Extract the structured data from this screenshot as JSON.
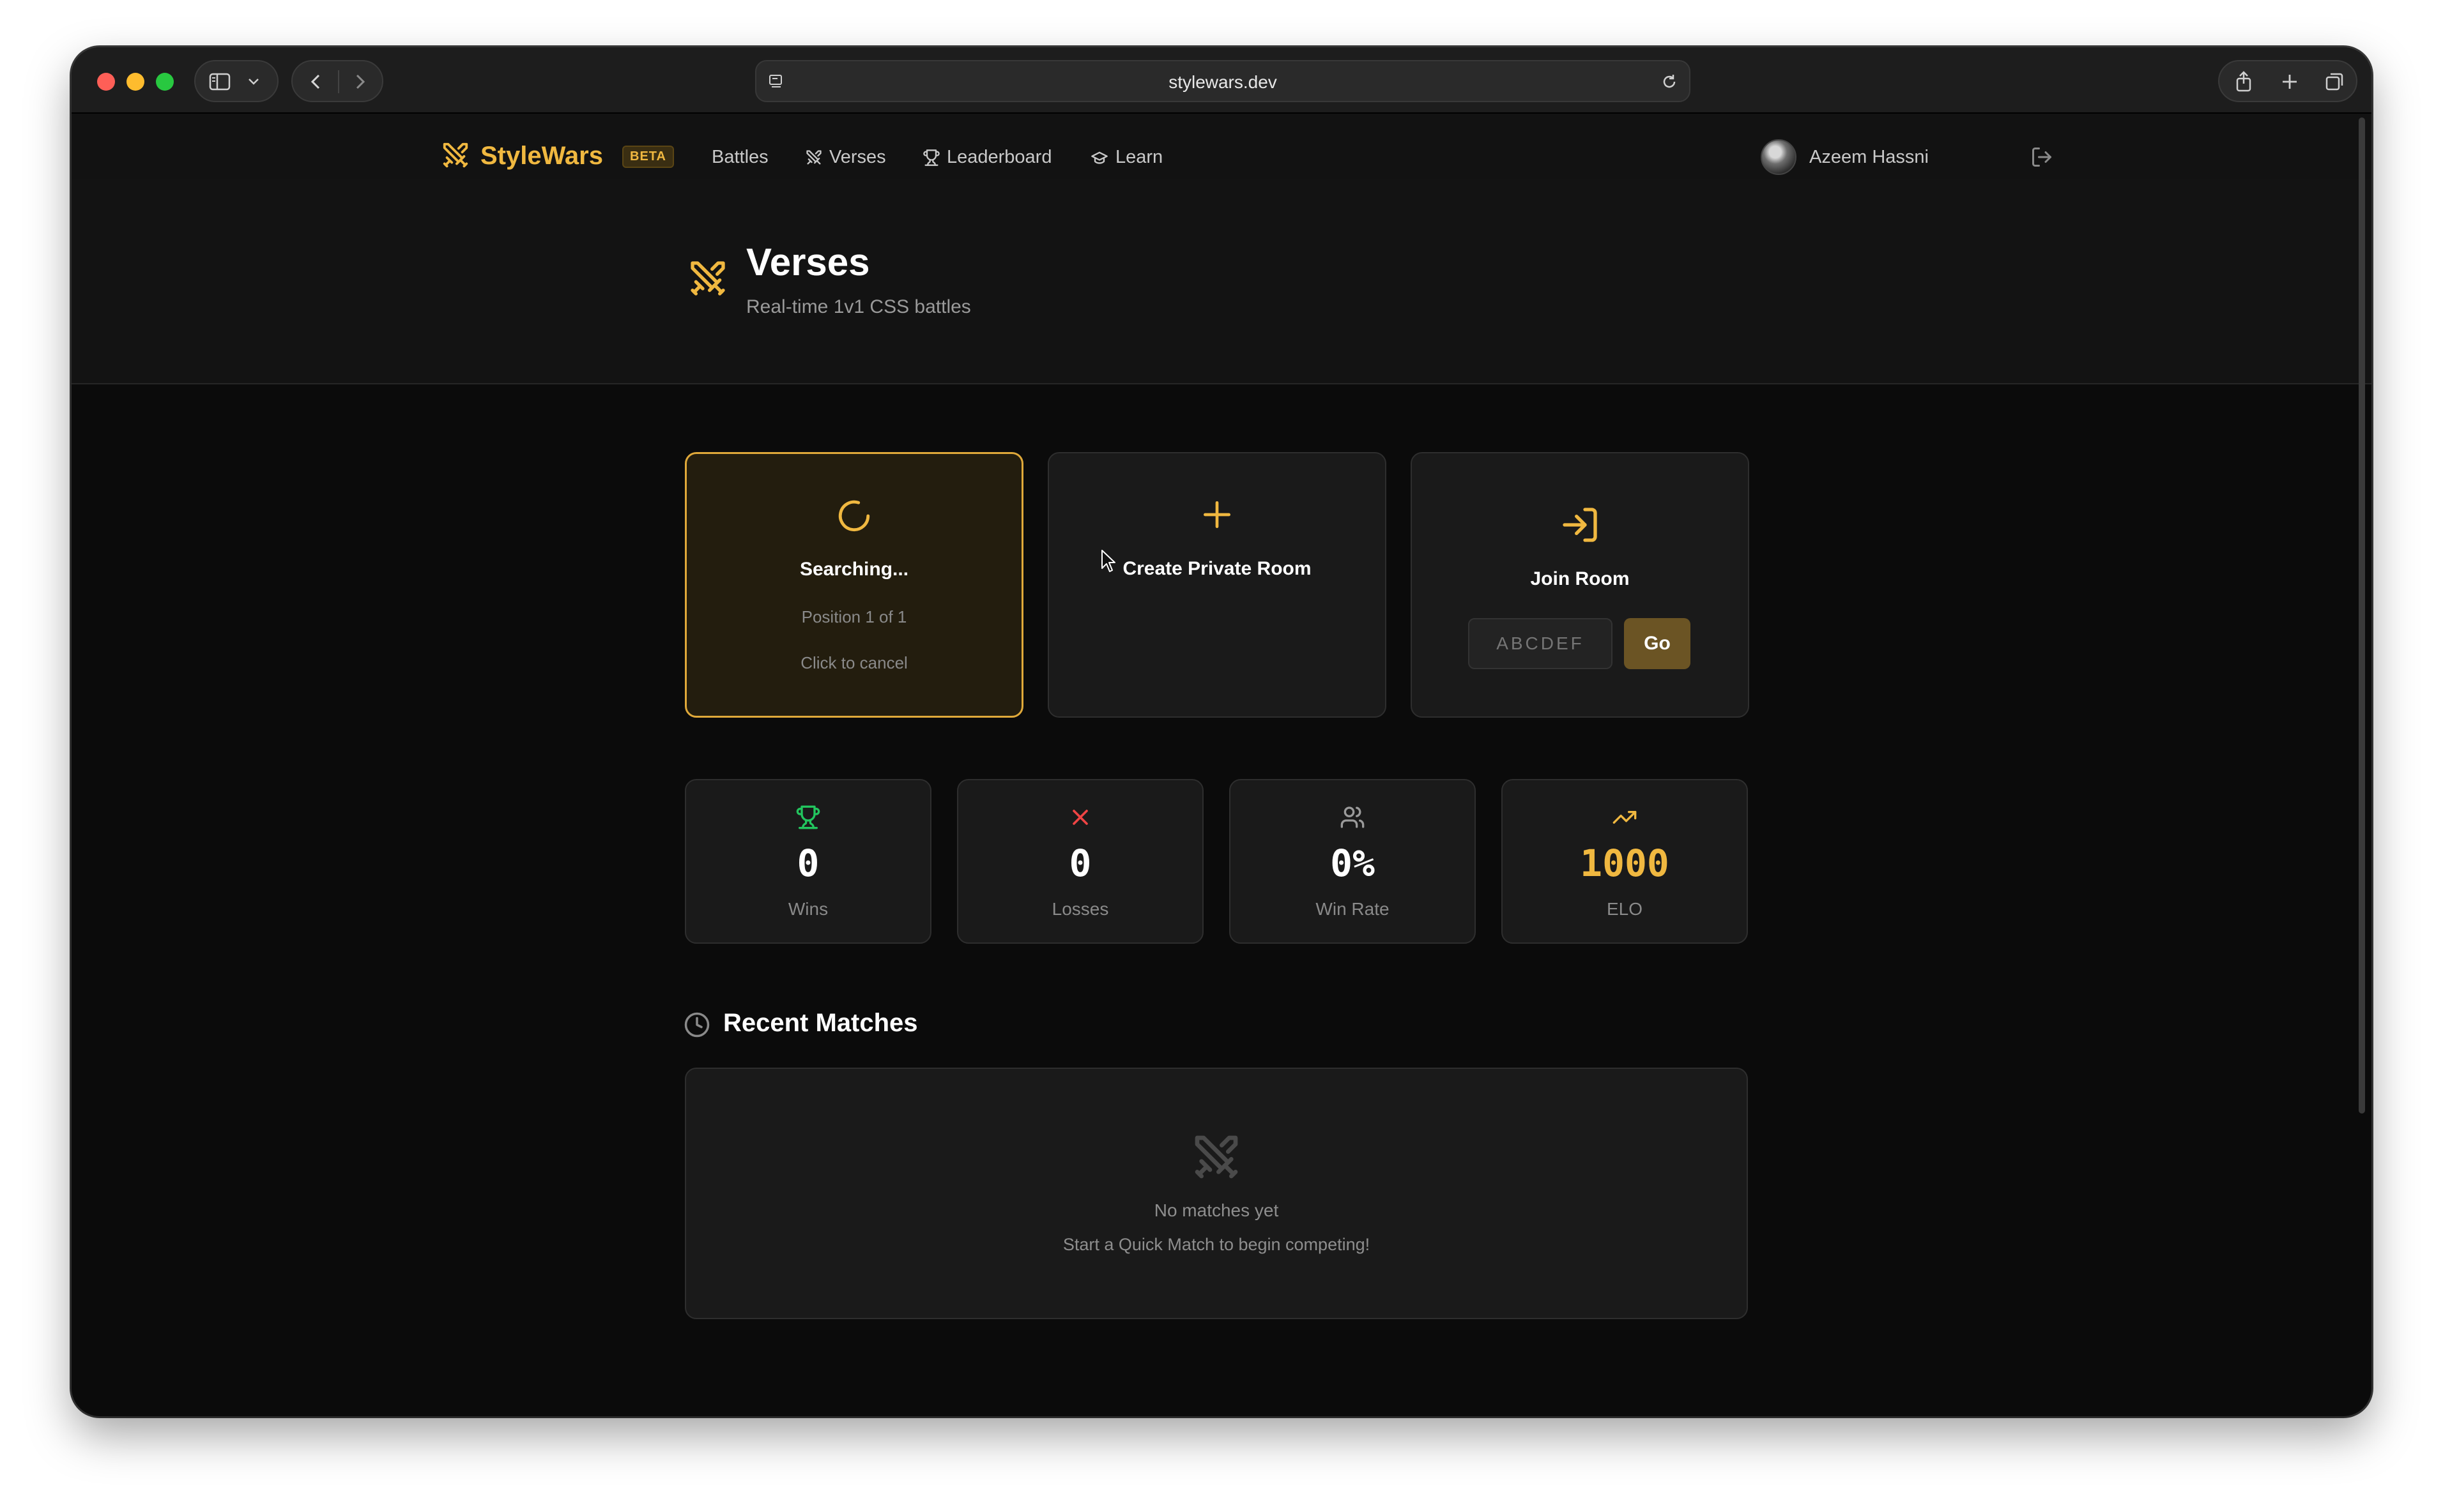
{
  "browser": {
    "url": "stylewars.dev"
  },
  "nav": {
    "brand": "StyleWars",
    "badge": "BETA",
    "links": [
      "Battles",
      "Verses",
      "Leaderboard",
      "Learn"
    ],
    "user": "Azeem Hassni"
  },
  "hero": {
    "title": "Verses",
    "subtitle": "Real-time 1v1 CSS battles"
  },
  "actions": {
    "quick": {
      "title": "Searching...",
      "position": "Position 1 of 1",
      "hint": "Click to cancel"
    },
    "private": {
      "title": "Create Private Room"
    },
    "join": {
      "title": "Join Room",
      "placeholder": "ABCDEF",
      "button": "Go"
    }
  },
  "stats": [
    {
      "value": "0",
      "label": "Wins",
      "icon": "trophy-icon",
      "color": "#22c55e"
    },
    {
      "value": "0",
      "label": "Losses",
      "icon": "x-icon",
      "color": "#ef4444"
    },
    {
      "value": "0%",
      "label": "Win Rate",
      "icon": "users-icon",
      "color": "#9a9a9a"
    },
    {
      "value": "1000",
      "label": "ELO",
      "icon": "trending-up-icon",
      "color": "#f0b840"
    }
  ],
  "recent": {
    "title": "Recent Matches",
    "empty_title": "No matches yet",
    "empty_subtitle": "Start a Quick Match to begin competing!"
  },
  "colors": {
    "accent": "#f0b840",
    "background": "#0b0b0b",
    "card": "#1a1a1a"
  }
}
